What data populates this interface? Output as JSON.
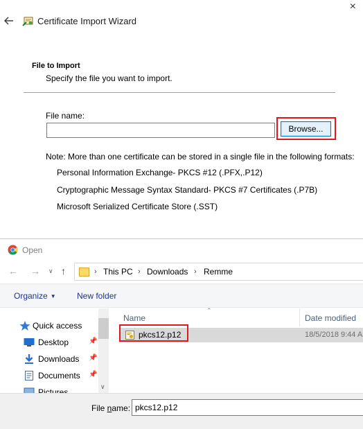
{
  "wizard": {
    "title": "Certificate Import Wizard",
    "section_title": "File to Import",
    "section_desc": "Specify the file you want to import.",
    "file_label": "File name:",
    "file_value": "",
    "browse_label": "Browse...",
    "note": "Note:  More than one certificate can be stored in a single file in the following formats:",
    "formats": [
      "Personal Information Exchange- PKCS #12 (.PFX,.P12)",
      "Cryptographic Message Syntax Standard- PKCS #7 Certificates (.P7B)",
      "Microsoft Serialized Certificate Store (.SST)"
    ],
    "close_glyph": "×",
    "highlight_color": "#e0181d"
  },
  "open_dialog": {
    "title": "Open",
    "breadcrumb": [
      "This PC",
      "Downloads",
      "Remme"
    ],
    "toolbar": {
      "organize": "Organize",
      "new_folder": "New folder"
    },
    "nav_pane": [
      {
        "label": "Quick access",
        "icon": "star-icon"
      },
      {
        "label": "Desktop",
        "icon": "desktop-icon"
      },
      {
        "label": "Downloads",
        "icon": "download-icon"
      },
      {
        "label": "Documents",
        "icon": "documents-icon"
      },
      {
        "label": "Pictures",
        "icon": "pictures-icon"
      }
    ],
    "columns": {
      "name": "Name",
      "date": "Date modified"
    },
    "files": [
      {
        "name": "pkcs12.p12",
        "date": "18/5/2018 9:44 A",
        "icon": "certificate-file-icon"
      }
    ],
    "file_name_label_pre": "File ",
    "file_name_label_u": "n",
    "file_name_label_post": "ame:",
    "file_name_value": "pkcs12.p12"
  }
}
